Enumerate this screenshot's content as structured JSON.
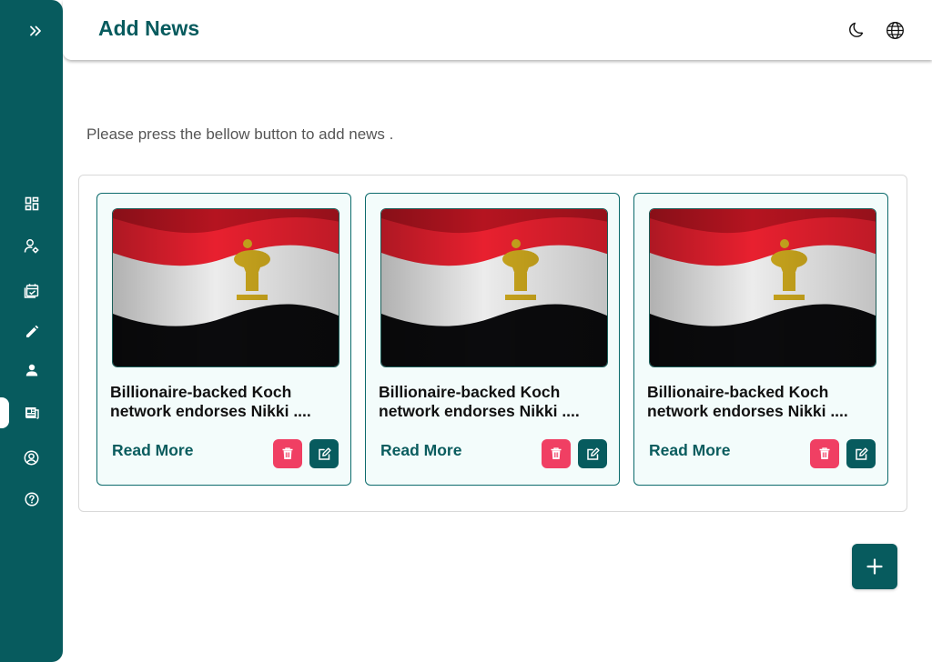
{
  "header": {
    "title": "Add News",
    "icons": {
      "theme": "moon-icon",
      "language": "globe-icon"
    }
  },
  "sidebar": {
    "toggle_icon": "double-chevron-right-icon",
    "items": [
      {
        "icon": "dashboard-icon",
        "active": false
      },
      {
        "icon": "user-settings-icon",
        "active": false
      },
      {
        "icon": "calendar-check-icon",
        "active": false
      },
      {
        "icon": "pencil-icon",
        "active": false
      },
      {
        "icon": "user-icon",
        "active": false
      },
      {
        "icon": "news-icon",
        "active": true
      },
      {
        "icon": "account-circle-icon",
        "active": false
      },
      {
        "icon": "help-icon",
        "active": false
      }
    ]
  },
  "main": {
    "intro": "Please press the bellow button to add news ."
  },
  "cards": [
    {
      "title": "Billionaire-backed Koch network endorses Nikki ....",
      "read_more": "Read More",
      "image": "egypt-flag"
    },
    {
      "title": "Billionaire-backed Koch network endorses Nikki ....",
      "read_more": "Read More",
      "image": "egypt-flag"
    },
    {
      "title": "Billionaire-backed Koch network endorses Nikki ....",
      "read_more": "Read More",
      "image": "egypt-flag"
    }
  ],
  "fab": {
    "icon": "plus-icon"
  },
  "colors": {
    "primary": "#075b5e",
    "danger": "#f03f63",
    "card_bg": "#f3fcfb"
  }
}
